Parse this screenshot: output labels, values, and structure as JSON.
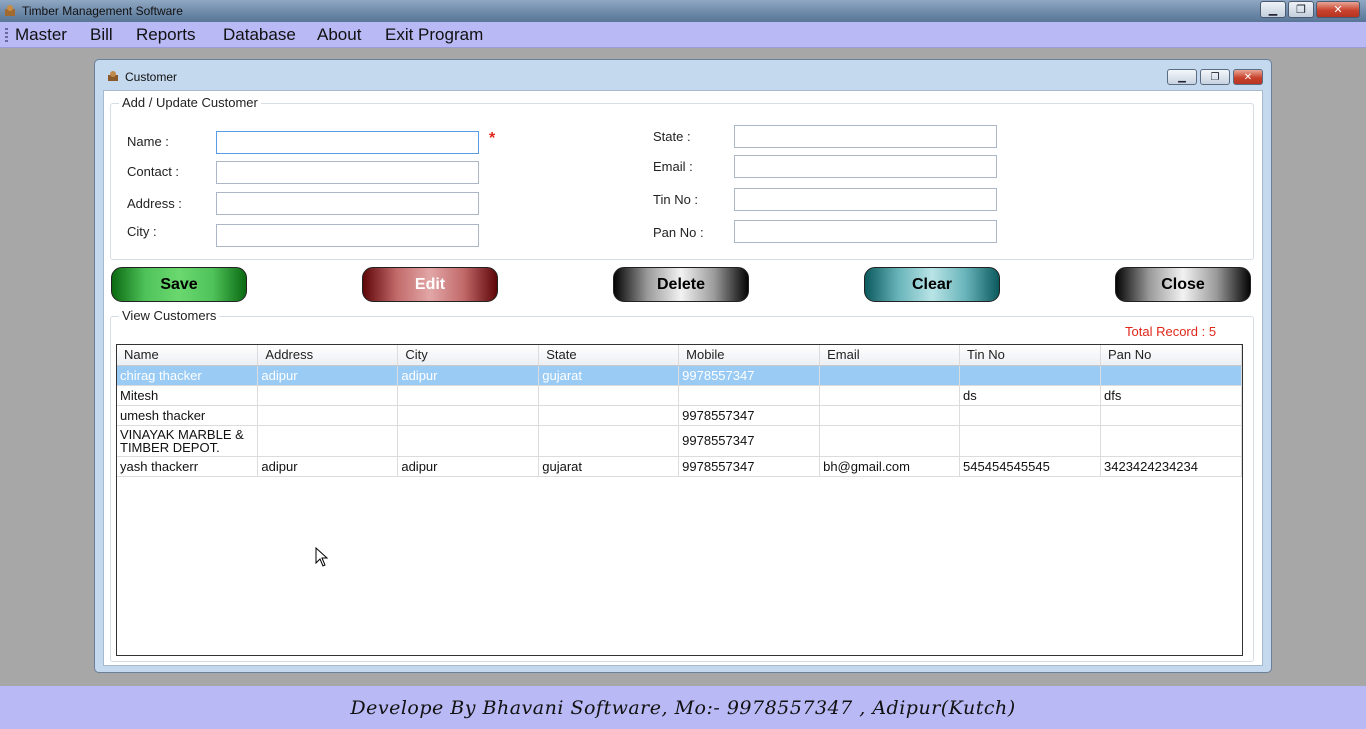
{
  "app": {
    "title": "Timber Management Software",
    "window_buttons": [
      "minimize",
      "restore",
      "close"
    ]
  },
  "menu": [
    {
      "label": "Master"
    },
    {
      "label": "Bill"
    },
    {
      "label": "Reports"
    },
    {
      "label": "Database"
    },
    {
      "label": "About"
    },
    {
      "label": "Exit Program"
    }
  ],
  "dialog": {
    "title": "Customer",
    "form": {
      "group_title": "Add / Update Customer",
      "required_mark": "*",
      "name": {
        "label": "Name :",
        "value": ""
      },
      "contact": {
        "label": "Contact :",
        "value": ""
      },
      "address": {
        "label": "Address :",
        "value": ""
      },
      "city": {
        "label": "City :",
        "value": ""
      },
      "state": {
        "label": "State :",
        "value": ""
      },
      "email": {
        "label": "Email :",
        "value": ""
      },
      "tin": {
        "label": "Tin No :",
        "value": ""
      },
      "pan": {
        "label": "Pan No :",
        "value": ""
      }
    },
    "buttons": {
      "save": "Save",
      "edit": "Edit",
      "delete": "Delete",
      "clear": "Clear",
      "close": "Close"
    },
    "view": {
      "group_title": "View Customers",
      "total_record": "Total Record : 5",
      "columns": [
        "Name",
        "Address",
        "City",
        "State",
        "Mobile",
        "Email",
        "Tin No",
        "Pan No"
      ],
      "rows": [
        [
          "chirag thacker",
          "adipur",
          "adipur",
          "gujarat",
          "9978557347",
          "",
          "",
          ""
        ],
        [
          "Mitesh",
          "",
          "",
          "",
          "",
          "",
          "ds",
          "dfs"
        ],
        [
          "umesh thacker",
          "",
          "",
          "",
          "9978557347",
          "",
          "",
          ""
        ],
        [
          "VINAYAK MARBLE & TIMBER DEPOT.",
          "",
          "",
          "",
          "9978557347",
          "",
          "",
          ""
        ],
        [
          "yash thackerr",
          "adipur",
          "adipur",
          "gujarat",
          "9978557347",
          "bh@gmail.com",
          "545454545545",
          "3423424234234"
        ]
      ],
      "selected_row": 0
    }
  },
  "footer": {
    "text": "Develope By Bhavani Software, Mo:- 9978557347 , Adipur(Kutch)"
  },
  "colors": {
    "menu_bg": "#b9b9f5",
    "selected_row": "#99cbf5",
    "required": "#e0271a"
  }
}
